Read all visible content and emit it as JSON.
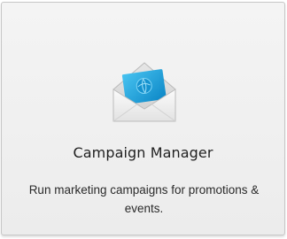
{
  "card": {
    "icon": "open-envelope-icon",
    "title": "Campaign Manager",
    "description": "Run marketing campaigns for promotions & events."
  },
  "colors": {
    "card_background": "#f0f0f0",
    "card_border": "#c6c6c6",
    "icon_accent": "#1a9ed8"
  }
}
